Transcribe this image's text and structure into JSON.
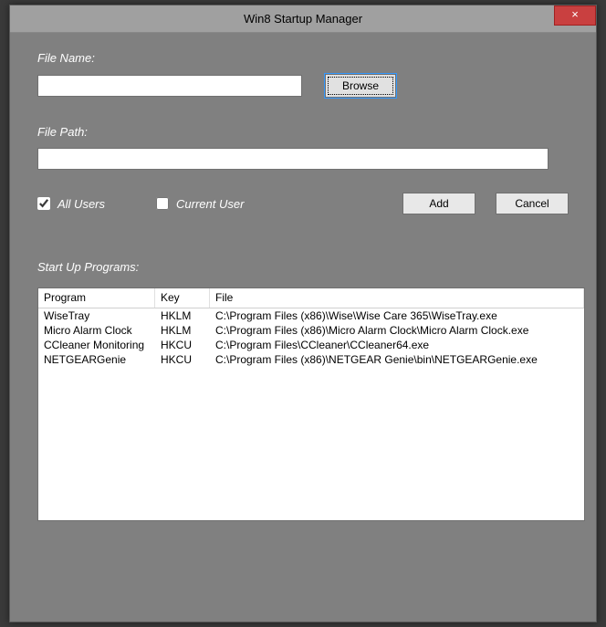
{
  "window": {
    "title": "Win8 Startup Manager",
    "close_label": "×"
  },
  "form": {
    "filename_label": "File Name:",
    "filename_value": "",
    "browse_label": "Browse",
    "filepath_label": "File Path:",
    "filepath_value": "",
    "all_users_label": "All Users",
    "all_users_checked": true,
    "current_user_label": "Current User",
    "current_user_checked": false,
    "add_label": "Add",
    "cancel_label": "Cancel"
  },
  "table": {
    "section_label": "Start Up Programs:",
    "headers": {
      "program": "Program",
      "key": "Key",
      "file": "File"
    },
    "rows": [
      {
        "program": "WiseTray",
        "key": "HKLM",
        "file": "C:\\Program Files (x86)\\Wise\\Wise Care 365\\WiseTray.exe"
      },
      {
        "program": "Micro Alarm Clock",
        "key": "HKLM",
        "file": "C:\\Program Files (x86)\\Micro Alarm Clock\\Micro Alarm Clock.exe"
      },
      {
        "program": "CCleaner Monitoring",
        "key": "HKCU",
        "file": "C:\\Program Files\\CCleaner\\CCleaner64.exe"
      },
      {
        "program": "NETGEARGenie",
        "key": "HKCU",
        "file": "C:\\Program Files (x86)\\NETGEAR Genie\\bin\\NETGEARGenie.exe"
      }
    ]
  }
}
